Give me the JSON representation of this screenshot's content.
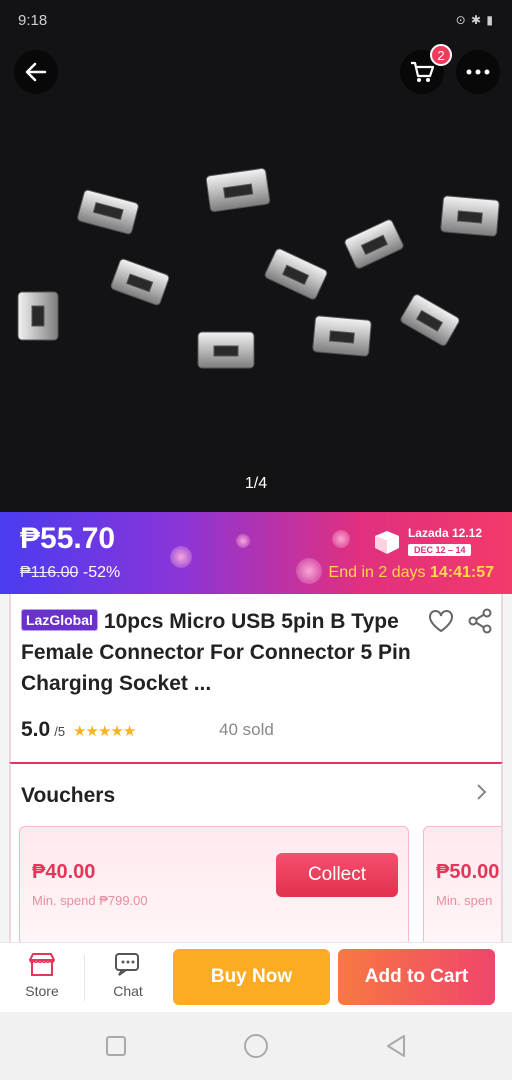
{
  "status_bar": {
    "time": "9:18",
    "right": "⊙ ✱ ▮"
  },
  "product_image": {
    "page_indicator": "1/4",
    "cart_count": "2"
  },
  "price": {
    "current": "₱55.70",
    "original": "₱116.00",
    "discount": "-52%"
  },
  "event": {
    "title": "Lazada 12.12",
    "dates": "DEC 12 – 14",
    "countdown_prefix": "End in 2 days",
    "countdown_time": "14:41:57"
  },
  "product": {
    "badge": "LazGlobal",
    "title": "10pcs Micro USB 5pin B Type Female Connector For Connector 5 Pin Charging Socket ...",
    "rating": "5.0",
    "rating_max": "/5",
    "stars": "★★★★★",
    "sold": "40 sold"
  },
  "vouchers": {
    "title": "Vouchers",
    "items": [
      {
        "amount": "₱40.00",
        "min_spend": "Min. spend ₱799.00",
        "button": "Collect"
      },
      {
        "amount": "₱50.00",
        "min_spend": "Min. spen"
      }
    ]
  },
  "bottom_bar": {
    "store": "Store",
    "chat": "Chat",
    "buy_now": "Buy Now",
    "add_to_cart": "Add to Cart"
  },
  "colors": {
    "accent": "#e4365b",
    "buy_now": "#fbac20",
    "add_to_cart": "#f0456b",
    "star": "#fbb120"
  }
}
